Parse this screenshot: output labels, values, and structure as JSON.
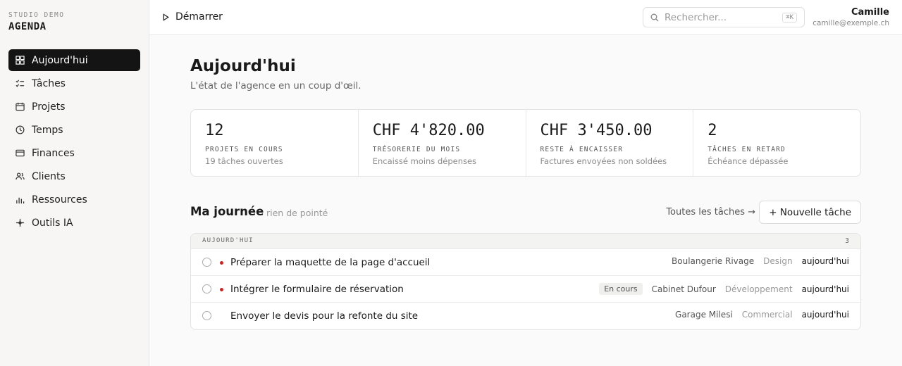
{
  "brand": {
    "subtitle": "STUDIO DEMO",
    "title": "AGENDA"
  },
  "sidebar": {
    "items": [
      {
        "label": "Aujourd'hui",
        "icon": "grid-icon",
        "active": true
      },
      {
        "label": "Tâches",
        "icon": "checklist-icon",
        "active": false
      },
      {
        "label": "Projets",
        "icon": "folder-icon",
        "active": false
      },
      {
        "label": "Temps",
        "icon": "clock-icon",
        "active": false
      },
      {
        "label": "Finances",
        "icon": "card-icon",
        "active": false
      },
      {
        "label": "Clients",
        "icon": "users-icon",
        "active": false
      },
      {
        "label": "Ressources",
        "icon": "bar-chart-icon",
        "active": false
      },
      {
        "label": "Outils IA",
        "icon": "sparkle-icon",
        "active": false
      }
    ]
  },
  "topbar": {
    "start_label": "Démarrer",
    "search": {
      "placeholder": "Rechercher...",
      "shortcut": "⌘K"
    },
    "user": {
      "name": "Camille",
      "email": "camille@exemple.ch"
    }
  },
  "page": {
    "title": "Aujourd'hui",
    "subtitle": "L'état de l'agence en un coup d'œil."
  },
  "stats": [
    {
      "value": "12",
      "label": "PROJETS EN COURS",
      "note": "19 tâches ouvertes"
    },
    {
      "value": "CHF 4'820.00",
      "label": "TRÉSORERIE DU MOIS",
      "note": "Encaissé moins dépenses"
    },
    {
      "value": "CHF 3'450.00",
      "label": "RESTE À ENCAISSER",
      "note": "Factures envoyées non soldées"
    },
    {
      "value": "2",
      "label": "TÂCHES EN RETARD",
      "note": "Échéance dépassée"
    }
  ],
  "day": {
    "title": "Ma journée",
    "note": "rien de pointé",
    "all_tasks_label": "Toutes les tâches →",
    "new_task_label": "+ Nouvelle tâche",
    "group_label": "AUJOURD'HUI",
    "group_count": "3",
    "tasks": [
      {
        "title": "Préparer la maquette de la page d'accueil",
        "urgent": true,
        "badge": "",
        "client": "Boulangerie Rivage",
        "category": "Design",
        "due": "aujourd'hui"
      },
      {
        "title": "Intégrer le formulaire de réservation",
        "urgent": true,
        "badge": "En cours",
        "client": "Cabinet Dufour",
        "category": "Développement",
        "due": "aujourd'hui"
      },
      {
        "title": "Envoyer le devis pour la refonte du site",
        "urgent": false,
        "badge": "",
        "client": "Garage Milesi",
        "category": "Commercial",
        "due": "aujourd'hui"
      }
    ]
  },
  "colors": {
    "accent_dark": "#141414",
    "urgent_dot": "#c62828"
  }
}
